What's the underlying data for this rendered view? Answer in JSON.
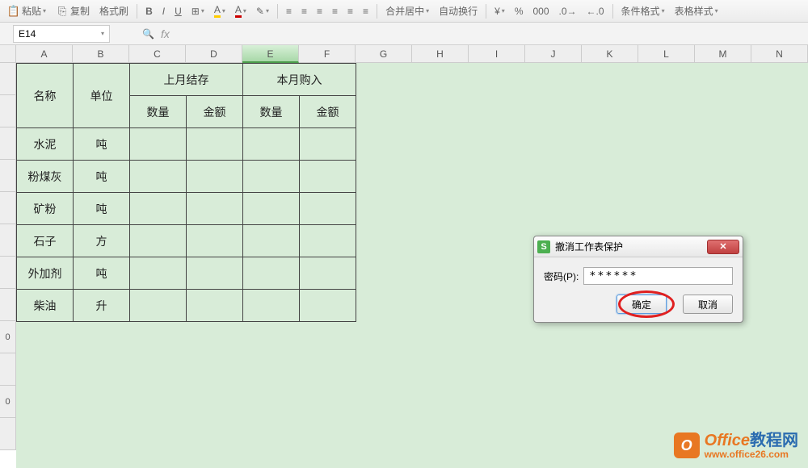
{
  "toolbar": {
    "paste": "粘贴",
    "copy": "复制",
    "format_painter": "格式刷",
    "merge_center": "合并居中",
    "auto_wrap": "自动换行",
    "conditional_format": "条件格式",
    "table_style": "表格样式"
  },
  "formula_bar": {
    "name_box": "E14",
    "fx": "fx"
  },
  "columns": [
    "A",
    "B",
    "C",
    "D",
    "E",
    "F",
    "G",
    "H",
    "I",
    "J",
    "K",
    "L",
    "M",
    "N"
  ],
  "rows": [
    "",
    "",
    "",
    "",
    "",
    "",
    "",
    "",
    "0",
    "",
    "0"
  ],
  "table": {
    "header": {
      "name": "名称",
      "unit": "单位",
      "last_month": "上月结存",
      "this_month": "本月购入",
      "qty": "数量",
      "amount": "金额"
    },
    "rows": [
      {
        "name": "水泥",
        "unit": "吨"
      },
      {
        "name": "粉煤灰",
        "unit": "吨"
      },
      {
        "name": "矿粉",
        "unit": "吨"
      },
      {
        "name": "石子",
        "unit": "方"
      },
      {
        "name": "外加剂",
        "unit": "吨"
      },
      {
        "name": "柴油",
        "unit": "升"
      }
    ]
  },
  "dialog": {
    "title": "撤消工作表保护",
    "password_label": "密码(P):",
    "password_value": "******",
    "ok": "确定",
    "cancel": "取消"
  },
  "watermark": {
    "brand1": "Office",
    "brand2": "教程网",
    "url": "www.office26.com"
  }
}
